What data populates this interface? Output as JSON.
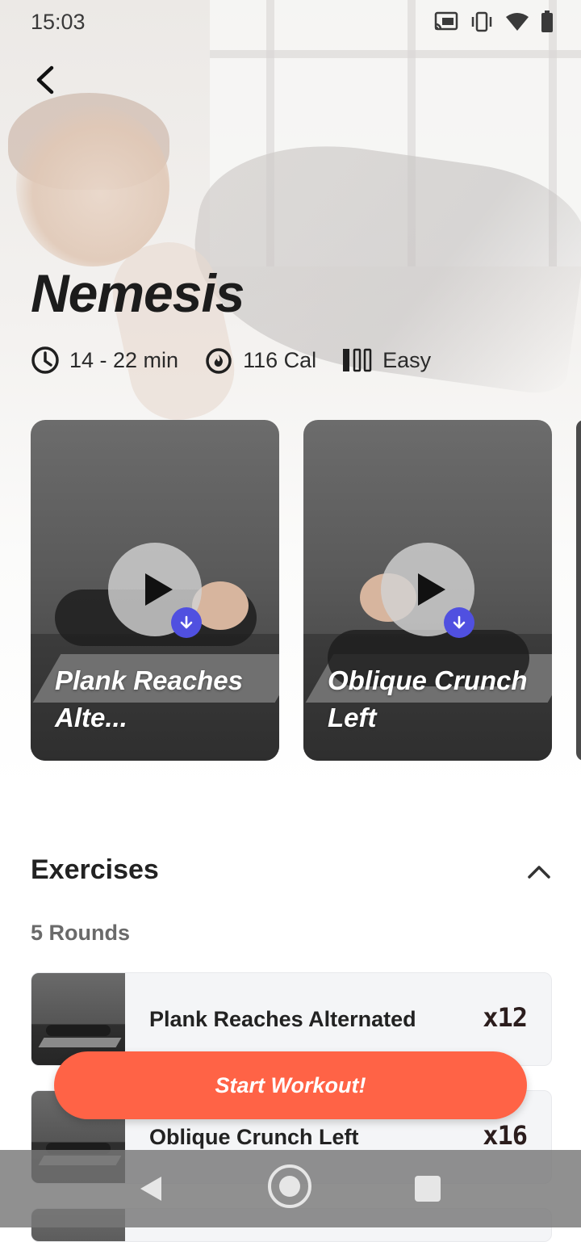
{
  "status_bar": {
    "time": "15:03"
  },
  "workout": {
    "title": "Nemesis",
    "duration": "14 - 22 min",
    "calories": "116 Cal",
    "difficulty": "Easy"
  },
  "carousel": [
    {
      "title": "Plank Reaches Alte..."
    },
    {
      "title": "Oblique Crunch Left"
    }
  ],
  "exercises": {
    "header": "Exercises",
    "rounds": "5 Rounds",
    "items": [
      {
        "name": "Plank Reaches Alternated",
        "reps": "x12"
      },
      {
        "name": "Oblique Crunch Left",
        "reps": "x16"
      }
    ]
  },
  "cta": {
    "label": "Start Workout!"
  },
  "colors": {
    "accent": "#ff6346",
    "download_badge": "#5050e0"
  }
}
